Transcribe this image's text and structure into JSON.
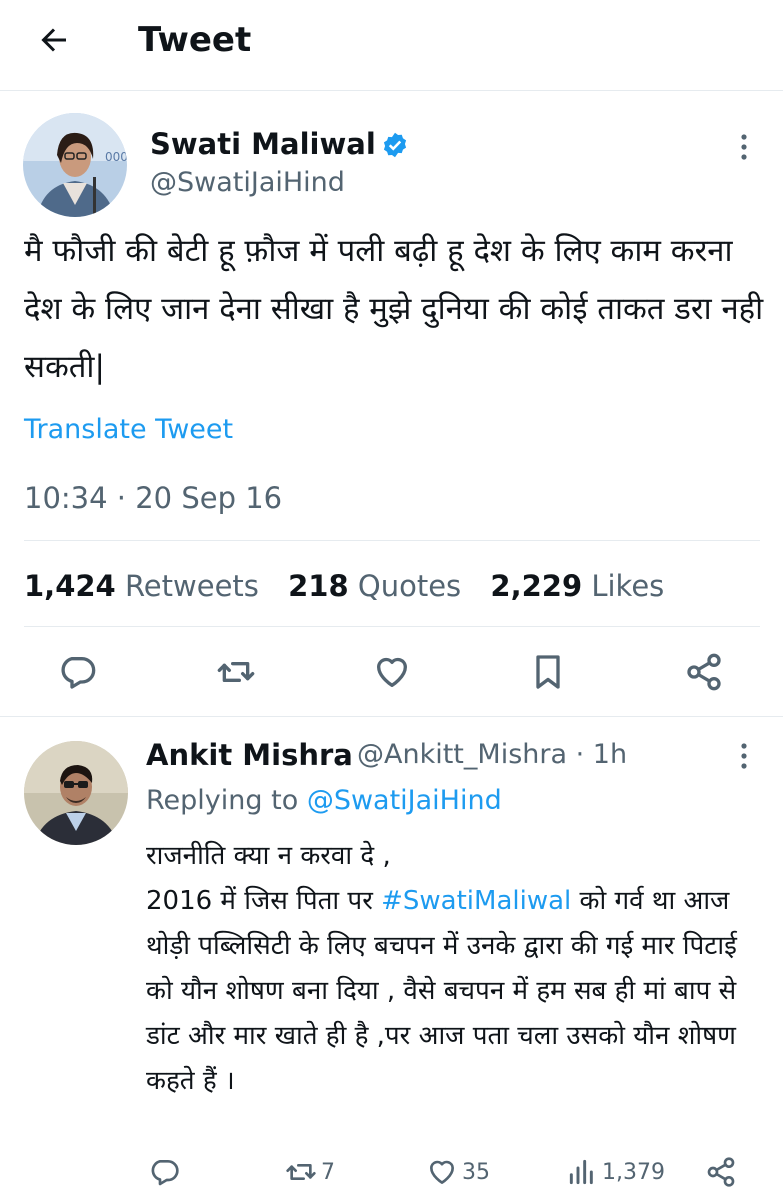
{
  "header": {
    "title": "Tweet"
  },
  "tweet": {
    "author_name": "Swati Maliwal",
    "handle": "@SwatiJaiHind",
    "text": "मै फौजी की बेटी हू फ़ौज में पली बढ़ी हू देश के लिए काम करना देश के लिए जान देना सीखा है मुझे दुनिया की कोई ताकत डरा नही सकती|",
    "translate_label": "Translate Tweet",
    "timestamp": "10:34 · 20 Sep 16",
    "retweets_count": "1,424",
    "retweets_label": "Retweets",
    "quotes_count": "218",
    "quotes_label": "Quotes",
    "likes_count": "2,229",
    "likes_label": "Likes"
  },
  "reply": {
    "author_name": "Ankit Mishra",
    "handle_time": "@Ankitt_Mishra · 1h",
    "replying_prefix": "Replying to",
    "replying_handle": "@SwatiJaiHind",
    "text_before_tag": "राजनीति क्या न करवा दे ,\n2016 में जिस पिता पर ",
    "hashtag": "#SwatiMaliwal",
    "text_after_tag": " को गर्व था आज थोड़ी पब्लिसिटी के लिए बचपन में उनके द्वारा की गई मार पिटाई को यौन शोषण बना दिया , वैसे बचपन में हम सब ही मां बाप से डांट और मार खाते ही है ,पर आज पता चला उसको यौन शोषण कहते हैं ।",
    "retweets": "7",
    "likes": "35",
    "views": "1,379"
  },
  "colors": {
    "accent": "#1d9bf0",
    "muted": "#536471",
    "text": "#0f1419",
    "divider": "#e6ebef"
  },
  "icons": [
    "back-arrow-icon",
    "verified-badge-icon",
    "more-options-icon",
    "reply-icon",
    "retweet-icon",
    "like-icon",
    "bookmark-icon",
    "share-icon",
    "views-icon"
  ]
}
